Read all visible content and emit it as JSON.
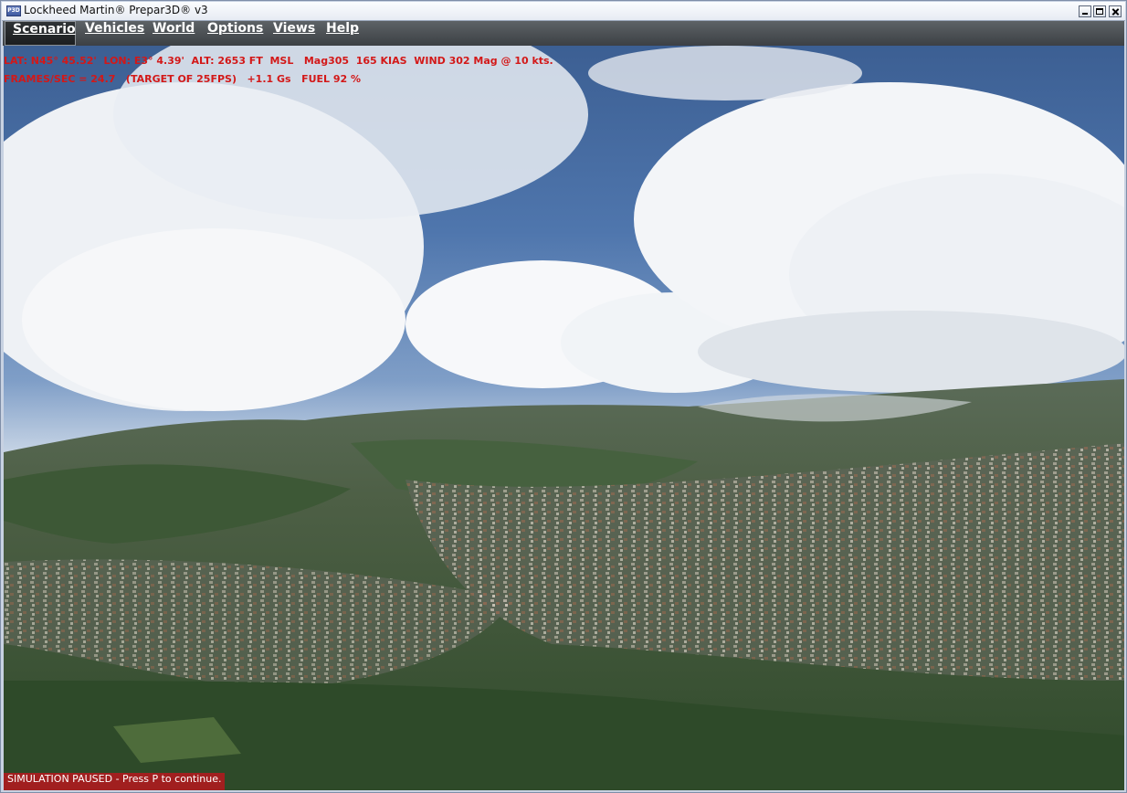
{
  "window": {
    "title": "Lockheed Martin® Prepar3D® v3",
    "app_icon_text": "P3D",
    "controls": [
      "minimize-icon",
      "maximize-icon",
      "close-icon"
    ]
  },
  "menubar": {
    "items": [
      {
        "label": "Scenario",
        "active": true
      },
      {
        "label": "Vehicles",
        "active": false
      },
      {
        "label": "World",
        "active": false
      },
      {
        "label": "Options",
        "active": false
      },
      {
        "label": "Views",
        "active": false
      },
      {
        "label": "Help",
        "active": false
      }
    ]
  },
  "hud": {
    "line1": "LAT: N45° 45.52'  LON: E3° 4.39'  ALT: 2653 FT  MSL   Mag305  165 KIAS  WIND 302 Mag @ 10 kts.",
    "line2": "FRAMES/SEC = 24.7   (TARGET OF 25FPS)   +1.1 Gs   FUEL 92 %",
    "color": "#d31818"
  },
  "status": {
    "message": "SIMULATION PAUSED - Press P to continue.",
    "background": "#a11f1f"
  },
  "colors": {
    "menubar": "#4a4e52",
    "sky": "#4f76ad",
    "terrain": "#3f5a33"
  }
}
